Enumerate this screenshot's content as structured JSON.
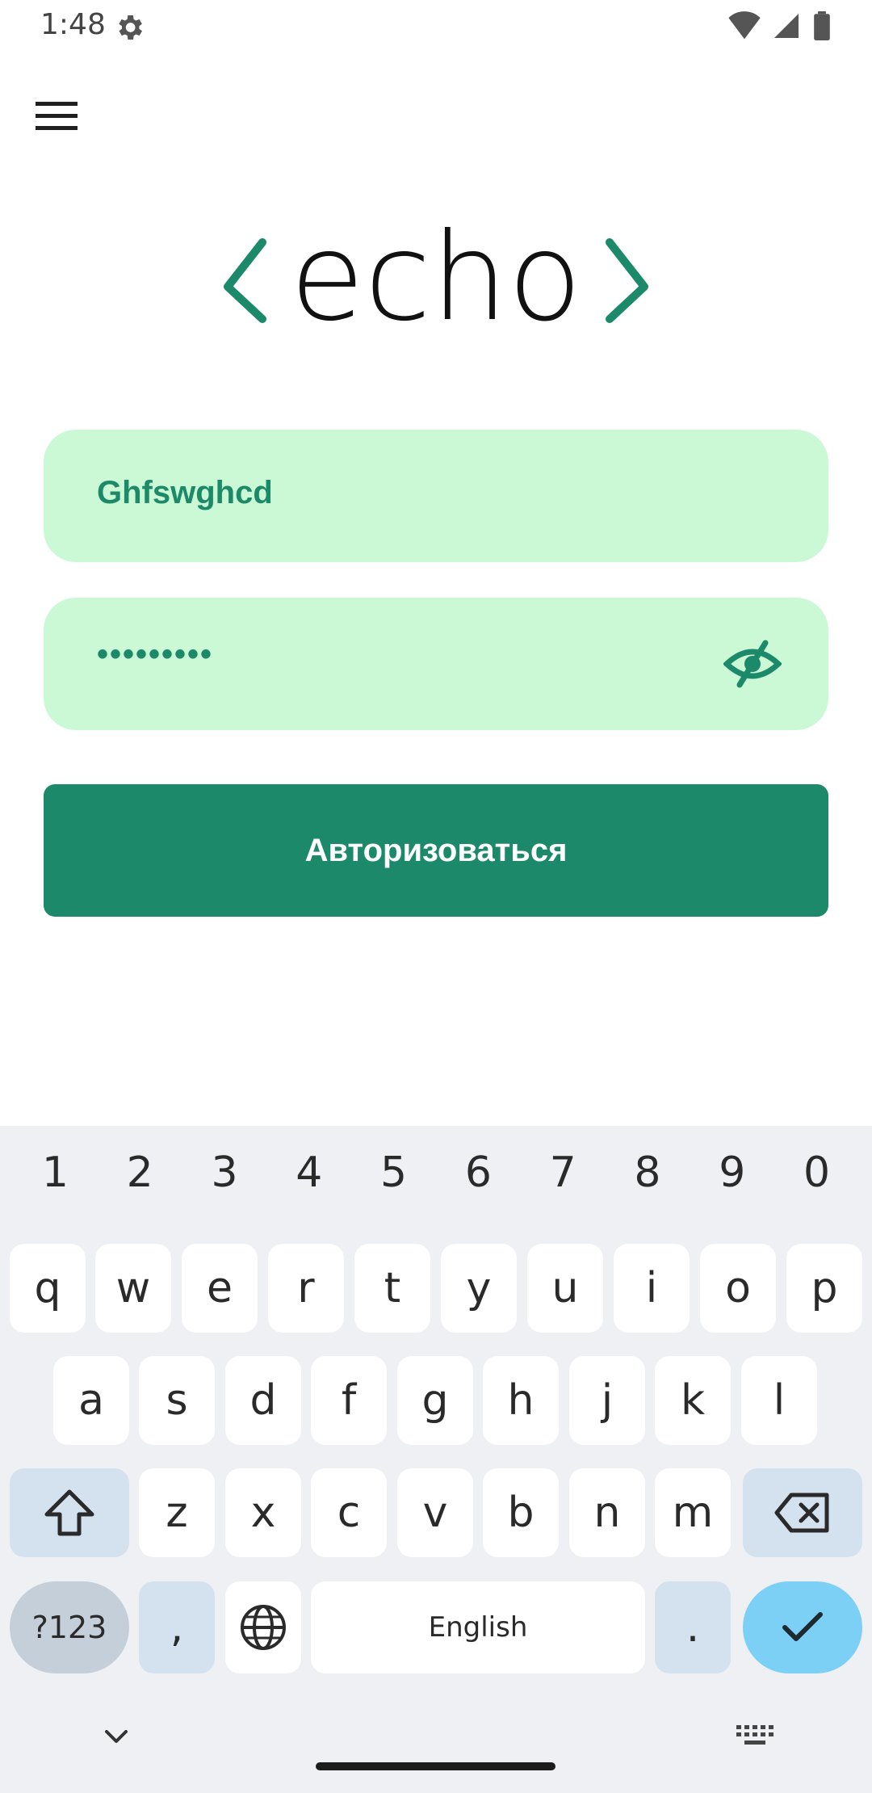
{
  "status": {
    "time": "1:48"
  },
  "header": {
    "menu_icon": "hamburger-menu-icon"
  },
  "logo": {
    "text": "echo"
  },
  "form": {
    "login_value": "Ghfswghcd",
    "password_value": "•••••••••",
    "login_button": "Авторизоваться"
  },
  "colors": {
    "field_bg": "#ccf9d5",
    "accent": "#1c8a6a",
    "enter_key": "#7cd0f6"
  },
  "keyboard": {
    "numbers": [
      "1",
      "2",
      "3",
      "4",
      "5",
      "6",
      "7",
      "8",
      "9",
      "0"
    ],
    "row1": [
      "q",
      "w",
      "e",
      "r",
      "t",
      "y",
      "u",
      "i",
      "o",
      "p"
    ],
    "row2": [
      "a",
      "s",
      "d",
      "f",
      "g",
      "h",
      "j",
      "k",
      "l"
    ],
    "row3": [
      "z",
      "x",
      "c",
      "v",
      "b",
      "n",
      "m"
    ],
    "symbols_label": "?123",
    "comma": ",",
    "space_label": "English",
    "period": "."
  }
}
